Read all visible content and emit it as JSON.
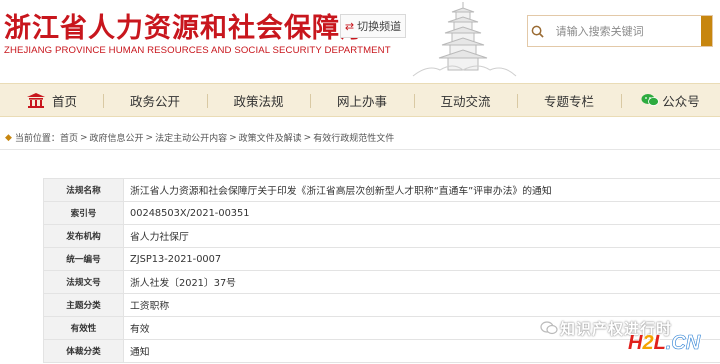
{
  "header": {
    "title": "浙江省人力资源和社会保障厅",
    "subtitle": "ZHEJIANG PROVINCE HUMAN RESOURCES AND SOCIAL SECURITY DEPARTMENT",
    "switch_label": "切换频道",
    "search_placeholder": "请输入搜索关键词",
    "brand_color": "#c8161d"
  },
  "nav": {
    "items": [
      {
        "label": "首页",
        "icon": "home-icon"
      },
      {
        "label": "政务公开"
      },
      {
        "label": "政策法规"
      },
      {
        "label": "网上办事"
      },
      {
        "label": "互动交流"
      },
      {
        "label": "专题专栏"
      },
      {
        "label": "公众号",
        "icon": "wechat-icon"
      }
    ],
    "background": "#f6eeda"
  },
  "breadcrumb": {
    "prefix": "当前位置：",
    "items": [
      "首页",
      "政府信息公开",
      "法定主动公开内容",
      "政策文件及解读",
      "有效行政规范性文件"
    ],
    "separator": ">"
  },
  "info_table": {
    "rows": [
      {
        "label": "法规名称",
        "value": "浙江省人力资源和社会保障厅关于印发《浙江省高层次创新型人才职称“直通车”评审办法》的通知"
      },
      {
        "label": "索引号",
        "value": "00248503X/2021-00351"
      },
      {
        "label": "发布机构",
        "value": "省人力社保厅"
      },
      {
        "label": "统一编号",
        "value": "ZJSP13-2021-0007"
      },
      {
        "label": "法规文号",
        "value": "浙人社发〔2021〕37号"
      },
      {
        "label": "主题分类",
        "value": "工资职称"
      },
      {
        "label": "有效性",
        "value": "有效"
      },
      {
        "label": "体裁分类",
        "value": "通知"
      }
    ]
  },
  "watermark": {
    "text": "知识产权进行时",
    "logo": "H2L.CN"
  }
}
